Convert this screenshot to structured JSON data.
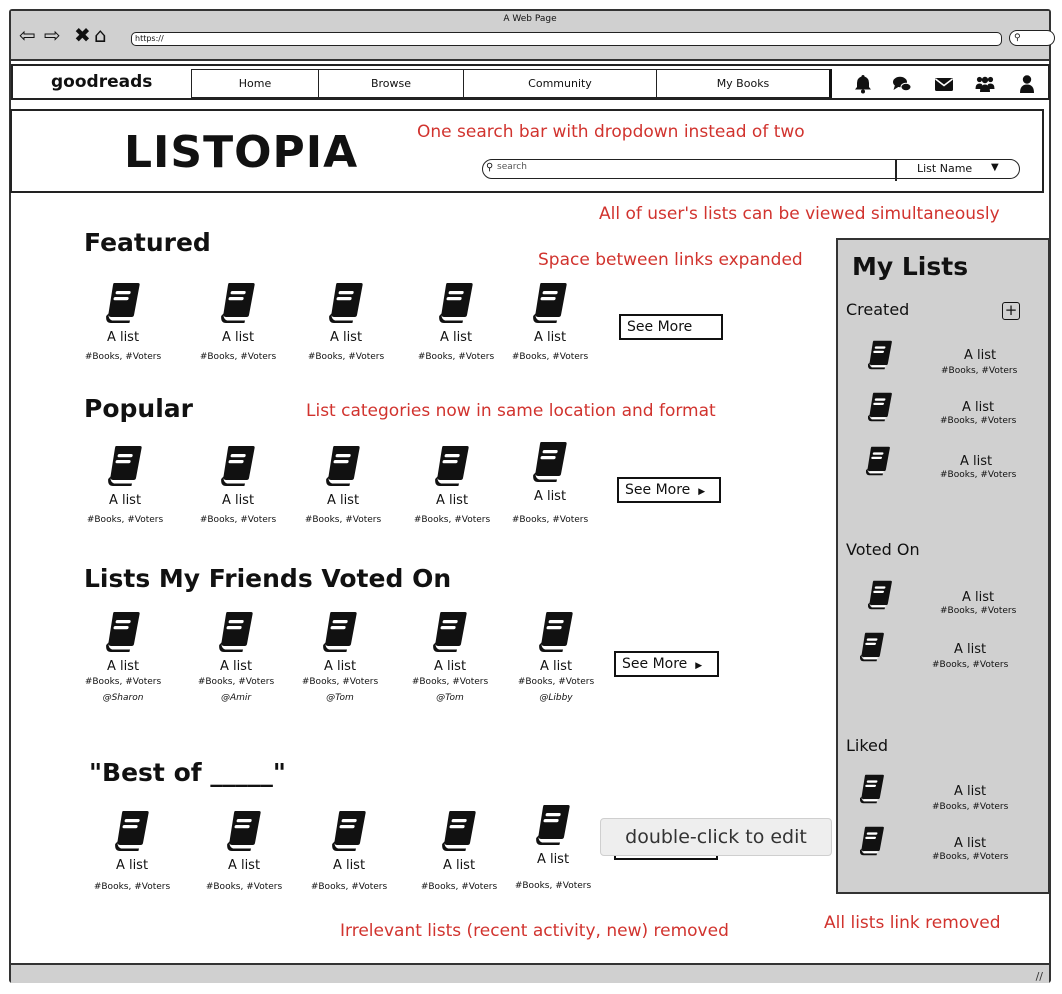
{
  "window": {
    "title": "A Web Page",
    "url": "https://"
  },
  "nav": {
    "logo": "goodreads",
    "links": [
      "Home",
      "Browse",
      "Community",
      "My Books"
    ],
    "icons": [
      "bell-icon",
      "chat-icon",
      "mail-icon",
      "friends-icon",
      "user-icon"
    ]
  },
  "header": {
    "title": "LISTOPIA",
    "search_placeholder": "search",
    "dropdown_value": "List Name"
  },
  "annotations": {
    "search": "One search bar with dropdown instead of two",
    "simultaneous": "All of user's lists can be viewed simultaneously",
    "spacing": "Space between links expanded",
    "categories": "List categories now in same location and format",
    "removed_lists": "Irrelevant lists (recent activity, new) removed",
    "all_lists_link": "All lists link removed"
  },
  "sections": [
    {
      "title": "Featured",
      "see_more": "See More",
      "items": [
        {
          "title": "A list",
          "tags": "#Books, #Voters"
        },
        {
          "title": "A list",
          "tags": "#Books, #Voters"
        },
        {
          "title": "A list",
          "tags": "#Books, #Voters"
        },
        {
          "title": "A list",
          "tags": "#Books, #Voters"
        },
        {
          "title": "A list",
          "tags": "#Books, #Voters"
        }
      ]
    },
    {
      "title": "Popular",
      "see_more": "See More",
      "items": [
        {
          "title": "A list",
          "tags": "#Books, #Voters"
        },
        {
          "title": "A list",
          "tags": "#Books, #Voters"
        },
        {
          "title": "A list",
          "tags": "#Books, #Voters"
        },
        {
          "title": "A list",
          "tags": "#Books, #Voters"
        },
        {
          "title": "A list",
          "tags": "#Books, #Voters"
        }
      ]
    },
    {
      "title": "Lists My Friends Voted On",
      "see_more": "See More",
      "items": [
        {
          "title": "A list",
          "tags": "#Books, #Voters",
          "user": "@Sharon"
        },
        {
          "title": "A list",
          "tags": "#Books, #Voters",
          "user": "@Amir"
        },
        {
          "title": "A list",
          "tags": "#Books, #Voters",
          "user": "@Tom"
        },
        {
          "title": "A list",
          "tags": "#Books, #Voters",
          "user": "@Tom"
        },
        {
          "title": "A list",
          "tags": "#Books, #Voters",
          "user": "@Libby"
        }
      ]
    },
    {
      "title": "\"Best of _____\"",
      "items": [
        {
          "title": "A list",
          "tags": "#Books, #Voters"
        },
        {
          "title": "A list",
          "tags": "#Books, #Voters"
        },
        {
          "title": "A list",
          "tags": "#Books, #Voters"
        },
        {
          "title": "A list",
          "tags": "#Books, #Voters"
        },
        {
          "title": "A list",
          "tags": "#Books, #Voters"
        }
      ]
    }
  ],
  "my_lists": {
    "title": "My Lists",
    "created": {
      "label": "Created",
      "items": [
        {
          "title": "A list",
          "tags": "#Books, #Voters"
        },
        {
          "title": "A list",
          "tags": "#Books, #Voters"
        },
        {
          "title": "A list",
          "tags": "#Books, #Voters"
        }
      ]
    },
    "voted_on": {
      "label": "Voted On",
      "items": [
        {
          "title": "A list",
          "tags": "#Books, #Voters"
        },
        {
          "title": "A list",
          "tags": "#Books, #Voters"
        }
      ]
    },
    "liked": {
      "label": "Liked",
      "items": [
        {
          "title": "A list",
          "tags": "#Books, #Voters"
        },
        {
          "title": "A list",
          "tags": "#Books, #Voters"
        }
      ]
    }
  },
  "tooltip": "double-click to edit"
}
